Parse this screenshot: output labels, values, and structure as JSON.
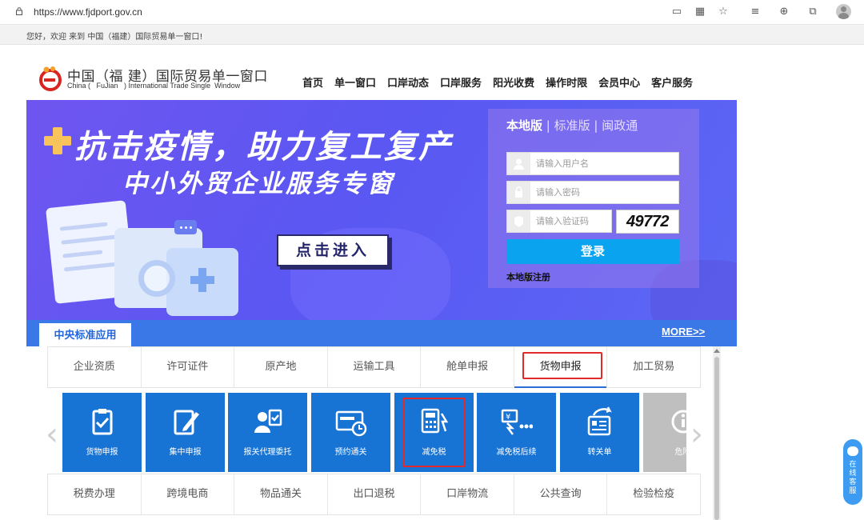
{
  "browser": {
    "url": "https://www.fjdport.gov.cn"
  },
  "welcome": "您好，欢迎  来到 中国（福建）国际贸易单一窗口!",
  "logo": {
    "cn": "中国（福 建）国际贸易单一窗口",
    "en": "China (   FuJian   ) International Trade Single  Window"
  },
  "nav": [
    "首页",
    "单一窗口",
    "口岸动态",
    "口岸服务",
    "阳光收费",
    "操作时限",
    "会员中心",
    "客户服务"
  ],
  "banner": {
    "headline": "抗击疫情，助力复工复产",
    "subline": "中小外贸企业服务专窗",
    "enter_button": "点击进入"
  },
  "login": {
    "tab_local": "本地版",
    "tab_standard": "标准版",
    "tab_mzt": "闽政通",
    "username_placeholder": "请输入用户名",
    "password_placeholder": "请输入密码",
    "captcha_placeholder": "请输入验证码",
    "captcha_code": "49772",
    "submit": "登录",
    "register": "本地版注册"
  },
  "strip": {
    "tab": "中央标准应用",
    "more": "MORE>>"
  },
  "category_tabs": [
    "企业资质",
    "许可证件",
    "原产地",
    "运输工具",
    "舱单申报",
    "货物申报",
    "加工贸易"
  ],
  "active_category": "货物申报",
  "tiles": [
    {
      "label": "货物申报",
      "icon": "clipboard-check-icon"
    },
    {
      "label": "集中申报",
      "icon": "edit-document-icon"
    },
    {
      "label": "报关代理委托",
      "icon": "agent-delegate-icon"
    },
    {
      "label": "预约通关",
      "icon": "schedule-clock-icon"
    },
    {
      "label": "减免税",
      "icon": "calculator-tax-icon"
    },
    {
      "label": "减免税后续",
      "icon": "tax-followup-icon"
    },
    {
      "label": "转关单",
      "icon": "transfer-document-icon"
    },
    {
      "label": "危险",
      "icon": "warning-icon"
    }
  ],
  "category_tabs_2": [
    "税费办理",
    "跨境电商",
    "物品通关",
    "出口退税",
    "口岸物流",
    "公共查询",
    "检验检疫"
  ],
  "float_service": "在线客服",
  "colors": {
    "tile_blue": "#1773d4",
    "banner_purple": "#6f55f0",
    "login_button": "#0aa3f0",
    "highlight_red": "#e32a2a"
  }
}
